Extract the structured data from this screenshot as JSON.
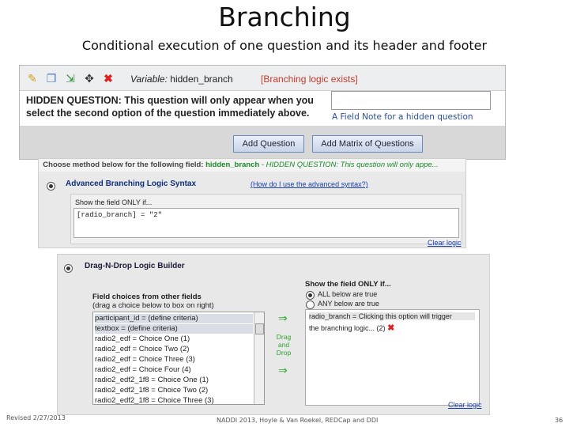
{
  "slide": {
    "title": "Branching",
    "subtitle": "Conditional execution of one question and its header and footer"
  },
  "editor": {
    "toolbar_icons": [
      "pencil-icon",
      "copy-icon",
      "branch-icon",
      "move-icon",
      "delete-x-icon"
    ],
    "variable_label": "Variable:",
    "variable_name": "hidden_branch",
    "branching_status": "[Branching logic exists]",
    "question_text": "HIDDEN QUESTION: This question will only appear when you select the second option of the question immediately above.",
    "field_note": "A Field Note for a hidden question",
    "add_question_label": "Add Question",
    "add_matrix_label": "Add Matrix of Questions"
  },
  "advanced": {
    "choose_prefix": "Choose method below for the following field:",
    "field_name": "hidden_branch",
    "field_desc": "- HIDDEN QUESTION: This question will only appe...",
    "title": "Advanced Branching Logic Syntax",
    "help_link": "(How do I use the advanced syntax?)",
    "show_label": "Show the field ONLY if...",
    "syntax": "[radio_branch] = \"2\"",
    "clear_label": "Clear logic"
  },
  "dnd": {
    "title": "Drag-N-Drop Logic Builder",
    "choices_title": "Field choices from other fields",
    "choices_sub": "(drag a choice below to box on right)",
    "choices": [
      "participant_id = (define criteria)",
      "textbox = (define criteria)",
      "radio2_edf = Choice One (1)",
      "radio2_edf = Choice Two (2)",
      "radio2_edf = Choice Three (3)",
      "radio2_edf = Choice Four (4)",
      "radio2_edf2_1f8 = Choice One (1)",
      "radio2_edf2_1f8 = Choice Two (2)",
      "radio2_edf2_1f8 = Choice Three (3)"
    ],
    "drag_label": "Drag and Drop",
    "show_only": "Show the field ONLY if...",
    "opt_all": "ALL below are true",
    "opt_any": "ANY below are true",
    "drop_line1": "radio_branch = Clicking this option will trigger",
    "drop_line2": "the branching logic... (2)",
    "clear_label": "Clear logic"
  },
  "footer": {
    "revised": "Revised 2/27/2013",
    "center": "NADDI 2013, Hoyle & Van Roekel, REDCap and DDI",
    "page": "36"
  },
  "colors": {
    "link": "#1a3fae",
    "field_green": "#1b8a2a",
    "warning_red": "#c0392b"
  }
}
